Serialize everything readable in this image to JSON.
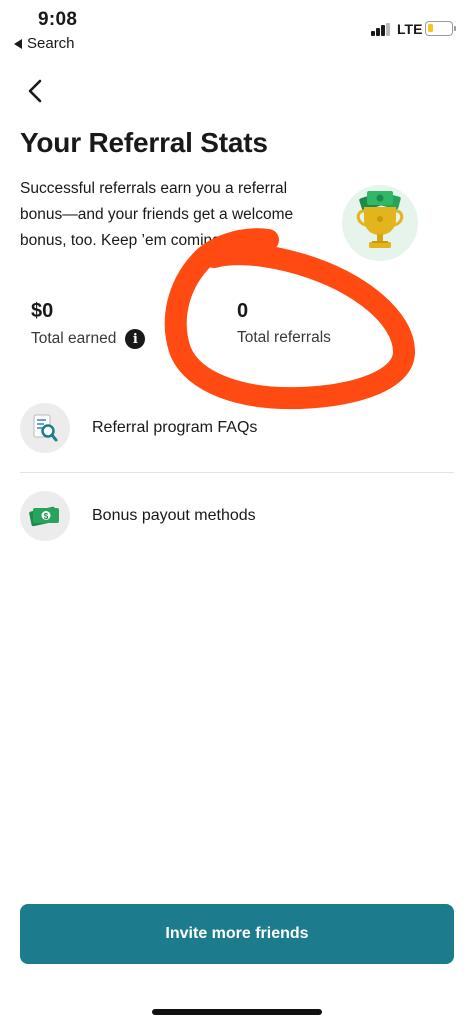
{
  "status_bar": {
    "time": "9:08",
    "back_label": "Search",
    "network": "LTE"
  },
  "header": {
    "back_icon": "chevron-left-icon",
    "title": "Your Referral Stats"
  },
  "description": "Successful referrals earn you a referral bonus—and your friends get a welcome bonus, too. Keep ’em coming.",
  "hero_icon": "trophy-money-icon",
  "stats": {
    "earned_value": "$0",
    "earned_label": "Total earned",
    "referrals_value": "0",
    "referrals_label": "Total referrals"
  },
  "menu": [
    {
      "label": "Referral program FAQs",
      "icon": "document-search-icon"
    },
    {
      "label": "Bonus payout methods",
      "icon": "dollar-bill-icon"
    }
  ],
  "cta": {
    "label": "Invite more friends"
  },
  "colors": {
    "primary": "#1c7b8c",
    "annotation": "#ff4a12",
    "hero_bg": "#e6f4ec",
    "money_green": "#1e8a4c",
    "trophy_gold": "#e3b51c"
  }
}
